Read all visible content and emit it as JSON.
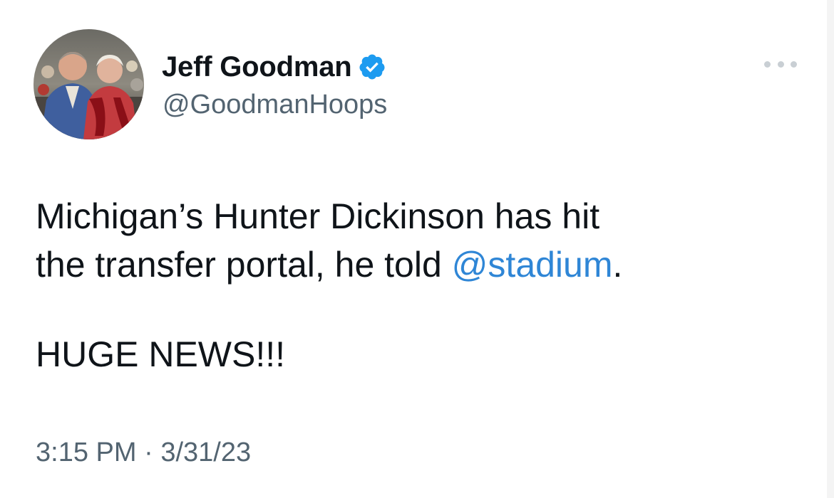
{
  "author": {
    "display_name": "Jeff Goodman",
    "handle": "@GoodmanHoops",
    "verified": true
  },
  "tweet": {
    "line1_prefix": "Michigan’s Hunter Dickinson has hit",
    "line2_prefix": "the transfer portal, he told ",
    "mention": "@stadium",
    "line2_suffix": ".",
    "paragraph2": "HUGE NEWS!!!"
  },
  "meta": {
    "time": "3:15 PM",
    "separator": " · ",
    "date": "3/31/23"
  },
  "colors": {
    "text": "#0f1419",
    "secondary": "#536471",
    "link": "#2f86d6",
    "verified": "#1d9bf0"
  },
  "icons": {
    "verified": "verified-badge-icon",
    "more": "more-options-icon"
  }
}
